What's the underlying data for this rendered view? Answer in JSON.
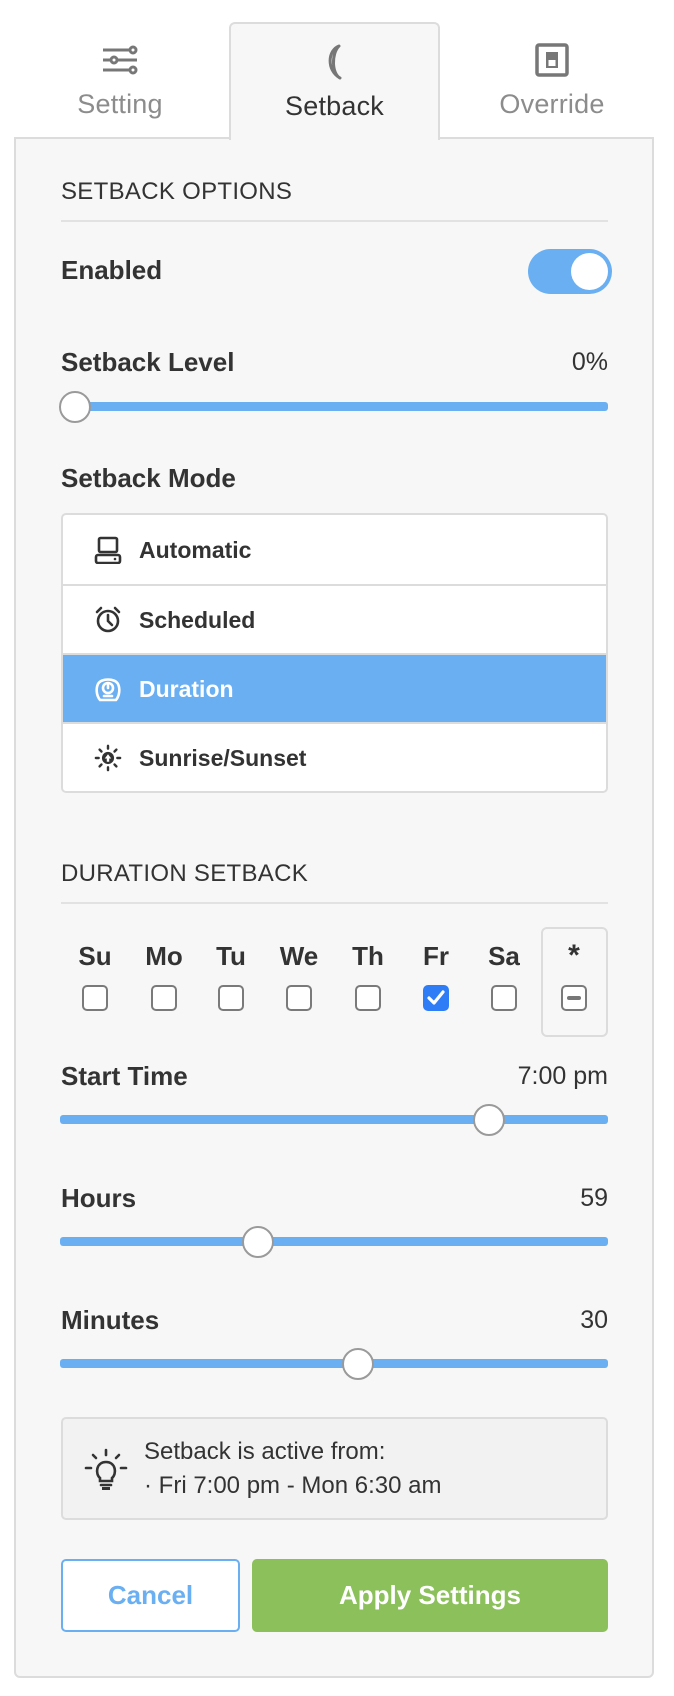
{
  "tabs": [
    {
      "label": "Setting",
      "icon": "sliders-icon",
      "active": false
    },
    {
      "label": "Setback",
      "icon": "moon-icon",
      "active": true
    },
    {
      "label": "Override",
      "icon": "switch-icon",
      "active": false
    }
  ],
  "setback_options": {
    "title": "SETBACK OPTIONS",
    "enabled": {
      "label": "Enabled",
      "value": true
    },
    "setback_level": {
      "label": "Setback Level",
      "value_text": "0%",
      "value": 0,
      "min": 0,
      "max": 100
    },
    "setback_mode": {
      "label": "Setback Mode",
      "options": [
        {
          "label": "Automatic",
          "icon": "computer-icon",
          "selected": false
        },
        {
          "label": "Scheduled",
          "icon": "alarm-clock-icon",
          "selected": false
        },
        {
          "label": "Duration",
          "icon": "timer-icon",
          "selected": true
        },
        {
          "label": "Sunrise/Sunset",
          "icon": "sunrise-icon",
          "selected": false
        }
      ]
    }
  },
  "duration_setback": {
    "title": "DURATION SETBACK",
    "days": [
      {
        "label": "Su",
        "checked": false
      },
      {
        "label": "Mo",
        "checked": false
      },
      {
        "label": "Tu",
        "checked": false
      },
      {
        "label": "We",
        "checked": false
      },
      {
        "label": "Th",
        "checked": false
      },
      {
        "label": "Fr",
        "checked": true
      },
      {
        "label": "Sa",
        "checked": false
      }
    ],
    "all_days": {
      "label": "*",
      "state": "indeterminate"
    },
    "start_time": {
      "label": "Start Time",
      "value_text": "7:00 pm",
      "value": 19,
      "min": 0,
      "max": 23.75
    },
    "hours": {
      "label": "Hours",
      "value_text": "59",
      "value": 59,
      "min": 0,
      "max": 167
    },
    "minutes": {
      "label": "Minutes",
      "value_text": "30",
      "value": 30,
      "min": 0,
      "max": 55
    }
  },
  "info": {
    "line1": "Setback is active from:",
    "line2": "· Fri 7:00 pm - Mon 6:30 am"
  },
  "buttons": {
    "cancel": "Cancel",
    "apply": "Apply Settings"
  },
  "colors": {
    "accent": "#6aaff2",
    "checkbox_checked": "#2f7df6",
    "apply": "#8bc05a",
    "panel_bg": "#f7f7f7",
    "border": "#dcdcdc"
  }
}
